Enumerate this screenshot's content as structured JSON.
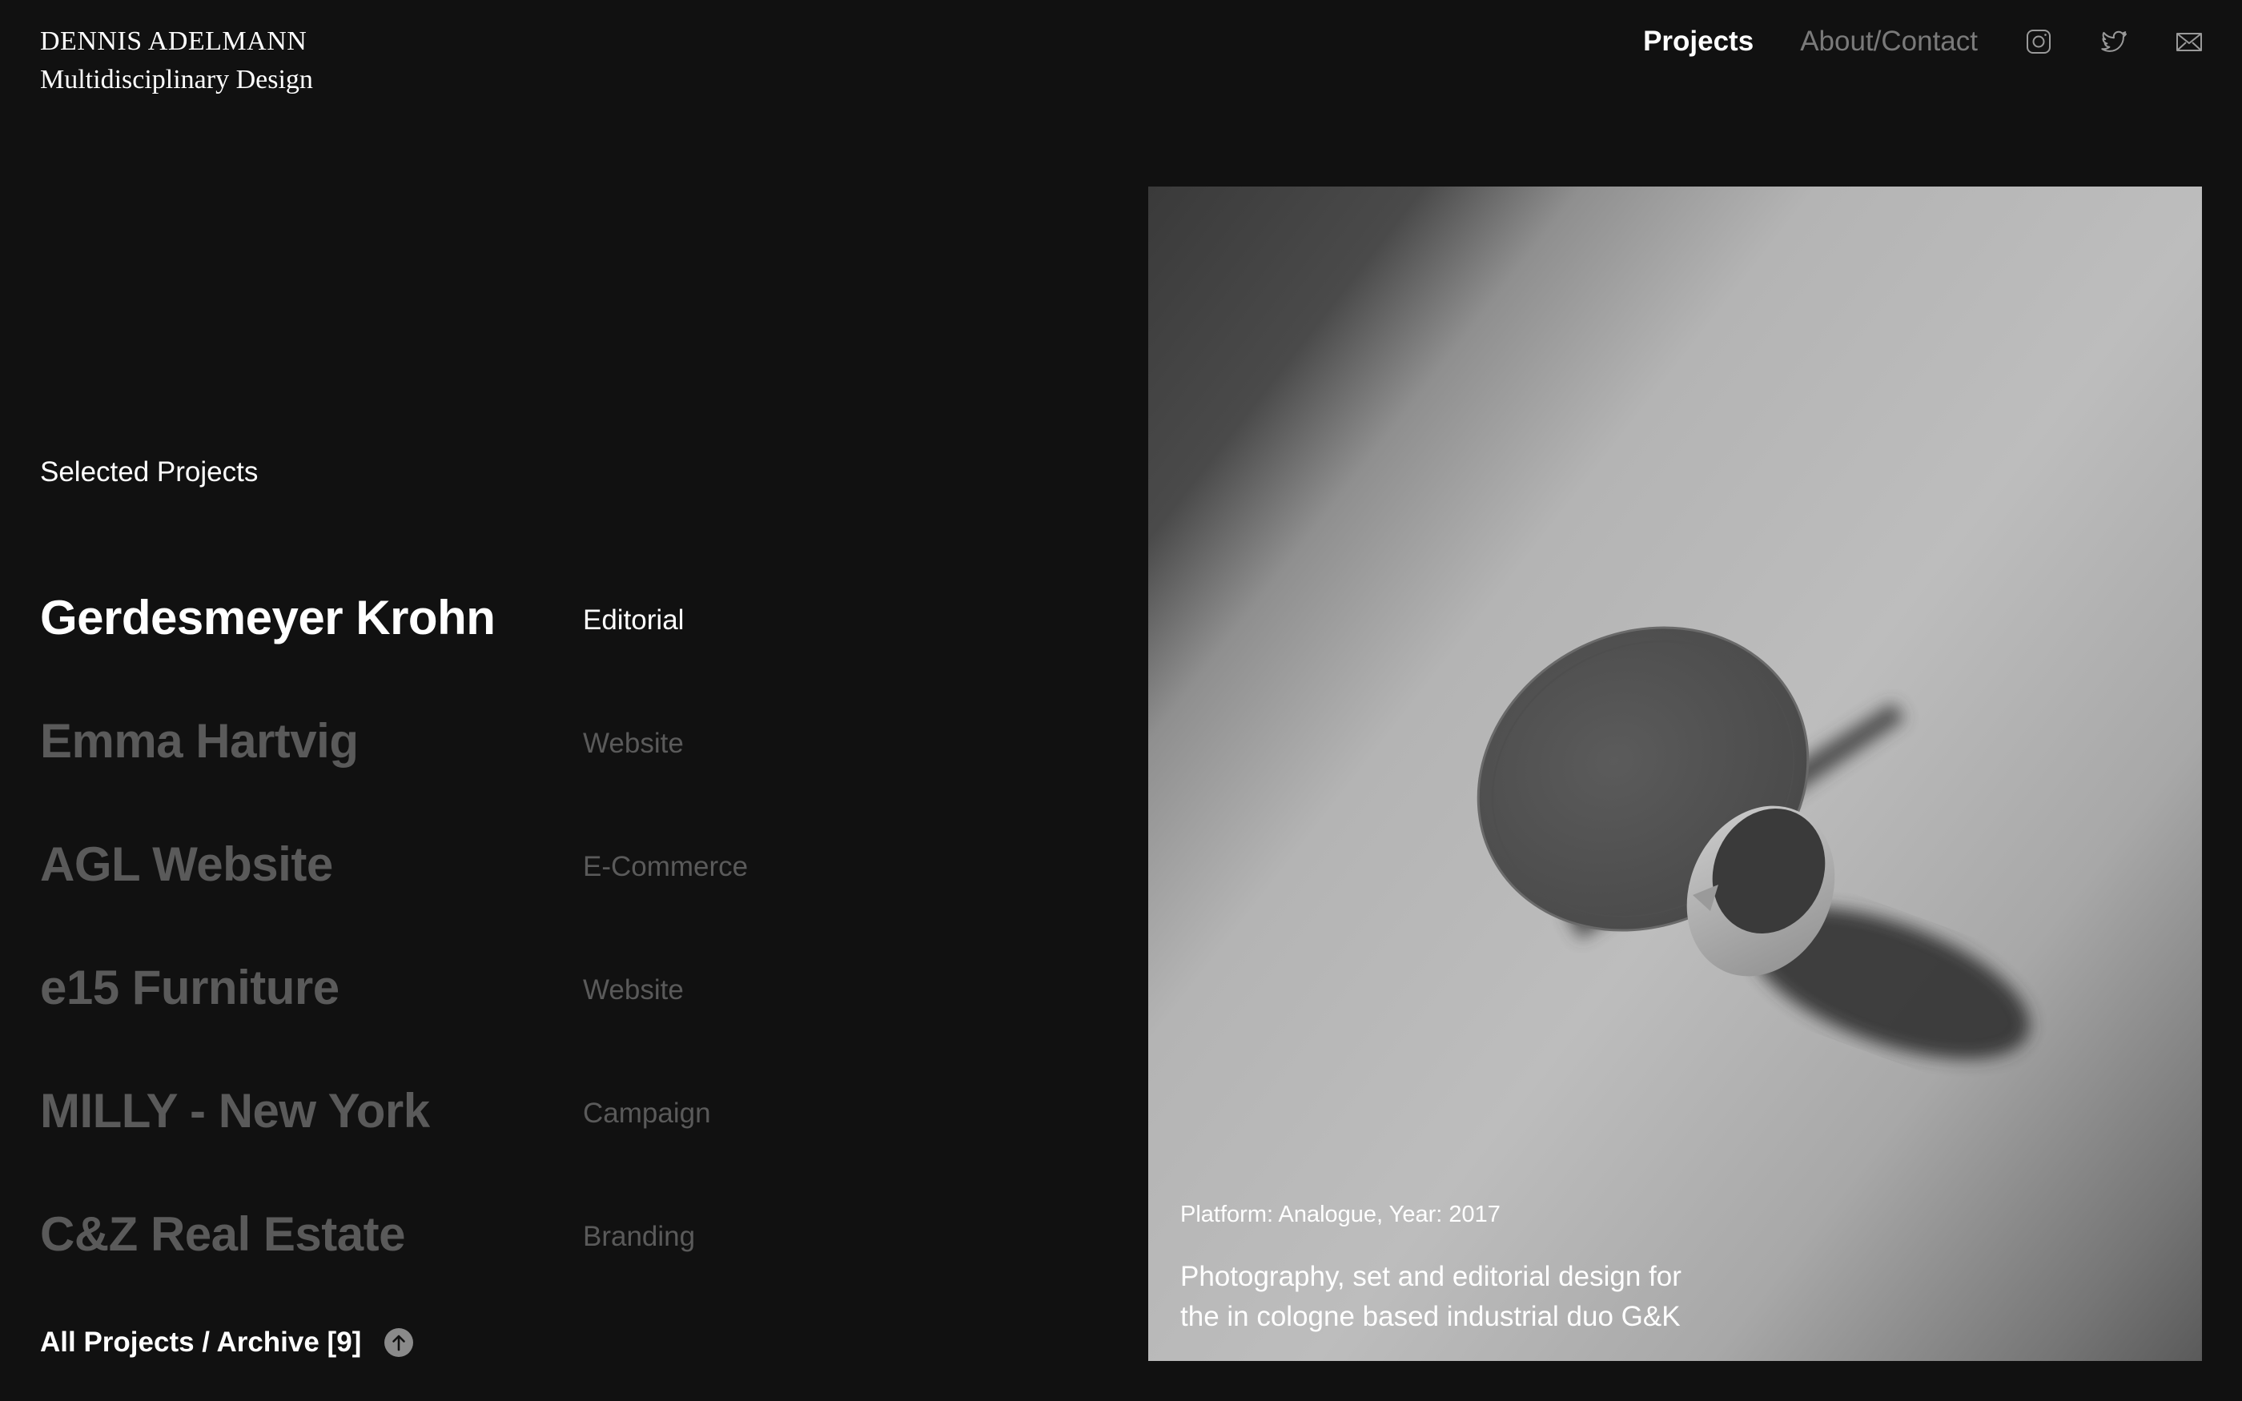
{
  "brand": {
    "name": "DENNIS ADELMANN",
    "tagline": "Multidisciplinary Design"
  },
  "nav": {
    "projects": "Projects",
    "about": "About/Contact",
    "icons": [
      "instagram-icon",
      "twitter-icon",
      "mail-icon"
    ]
  },
  "section": {
    "title": "Selected Projects"
  },
  "projects": [
    {
      "title": "Gerdesmeyer Krohn",
      "category": "Editorial",
      "active": true
    },
    {
      "title": "Emma Hartvig",
      "category": "Website",
      "active": false
    },
    {
      "title": "AGL Website",
      "category": "E-Commerce",
      "active": false
    },
    {
      "title": "e15 Furniture",
      "category": "Website",
      "active": false
    },
    {
      "title": "MILLY - New York",
      "category": "Campaign",
      "active": false
    },
    {
      "title": "C&Z Real Estate",
      "category": "Branding",
      "active": false
    }
  ],
  "archive": {
    "label": "All Projects / Archive [9]",
    "icon": "arrow-up-circle-icon"
  },
  "hero": {
    "meta": "Platform: Analogue, Year: 2017",
    "description_line1": "Photography, set and editorial design for",
    "description_line2": "the in cologne based industrial duo G&K"
  },
  "colors": {
    "background": "#111111",
    "text_active": "#ffffff",
    "text_dim": "#5a5a5a",
    "nav_inactive": "#7a7a7a"
  }
}
